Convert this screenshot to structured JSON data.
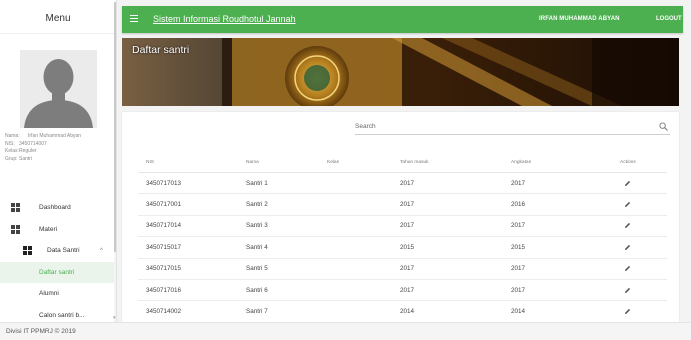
{
  "sidebar": {
    "title": "Menu",
    "user": {
      "rows": [
        {
          "k": "Nama:",
          "v": "Irfan Muhammad Abyan"
        },
        {
          "k": "NIS:",
          "v": "3450714007"
        },
        {
          "k": "Kelas:",
          "v": "Reguler"
        },
        {
          "k": "Grup:",
          "v": "Santri"
        }
      ]
    },
    "nav": {
      "dashboard": "Dashboard",
      "materi": "Materi",
      "data_santri": "Data Santri",
      "daftar_santri": "Daftar santri",
      "alumni": "Alumni",
      "calon_santri": "Calon santri b..."
    }
  },
  "header": {
    "title": "Sistem Informasi Roudhotul Jannah",
    "user_name": "IRFAN MUHAMMAD ABYAN",
    "logout": "LOGOUT"
  },
  "banner": {
    "title": "Daftar santri"
  },
  "search": {
    "label": "Search"
  },
  "table": {
    "headers": [
      "NIS",
      "Nama",
      "Kelas",
      "Tahun masuk",
      "Angkatan",
      "Actions"
    ],
    "rows": [
      {
        "nis": "3450717013",
        "nama": "Santri 1",
        "kelas": "",
        "tahun": "2017",
        "angkatan": "2017"
      },
      {
        "nis": "3450717001",
        "nama": "Santri 2",
        "kelas": "",
        "tahun": "2017",
        "angkatan": "2016"
      },
      {
        "nis": "3450717014",
        "nama": "Santri 3",
        "kelas": "",
        "tahun": "2017",
        "angkatan": "2017"
      },
      {
        "nis": "3450715017",
        "nama": "Santri 4",
        "kelas": "",
        "tahun": "2015",
        "angkatan": "2015"
      },
      {
        "nis": "3450717015",
        "nama": "Santri 5",
        "kelas": "",
        "tahun": "2017",
        "angkatan": "2017"
      },
      {
        "nis": "3450717016",
        "nama": "Santri 6",
        "kelas": "",
        "tahun": "2017",
        "angkatan": "2017"
      },
      {
        "nis": "3450714002",
        "nama": "Santri 7",
        "kelas": "",
        "tahun": "2014",
        "angkatan": "2014"
      }
    ]
  },
  "footer": {
    "text": "Divisi IT PPMRJ © 2019"
  },
  "colors": {
    "primary": "#4caf50",
    "active_bg": "#eaf4ea"
  },
  "icons": [
    "menu-icon",
    "avatar-icon",
    "dashboard-icon",
    "materi-icon",
    "data-santri-icon",
    "chevron-up-icon",
    "search-icon",
    "pencil-icon"
  ]
}
